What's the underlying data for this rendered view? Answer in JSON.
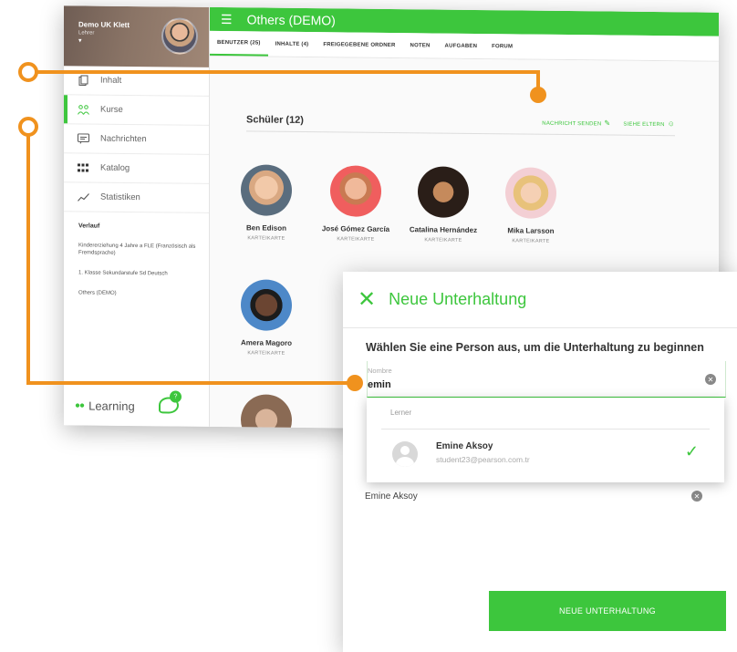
{
  "sidebar": {
    "profile_name": "Demo UK Klett",
    "profile_role": "Lehrer",
    "nav": [
      {
        "label": "Inhalt"
      },
      {
        "label": "Kurse"
      },
      {
        "label": "Nachrichten"
      },
      {
        "label": "Katalog"
      },
      {
        "label": "Statistiken"
      }
    ],
    "history_title": "Verlauf",
    "history": [
      "Kindererziehung 4 Jahre a FLE (Französisch als Fremdsprache)",
      "1. Klasse Sekundarstufe Sd Deutsch",
      "Others (DEMO)"
    ],
    "brand": "Learning",
    "chat_badge": "?"
  },
  "header": {
    "title": "Others (DEMO)",
    "tabs": [
      {
        "label": "BENUTZER (25)"
      },
      {
        "label": "INHALTE (4)"
      },
      {
        "label": "FREIGEGEBENE ORDNER"
      },
      {
        "label": "NOTEN"
      },
      {
        "label": "AUFGABEN"
      },
      {
        "label": "FORUM"
      }
    ]
  },
  "main": {
    "section_title": "Schüler (12)",
    "action_send": "NACHRICHT SENDEN",
    "action_parents": "SIEHE ELTERN",
    "students": [
      {
        "name": "Ben Edison",
        "tag": "KARTEIKARTE"
      },
      {
        "name": "José Gómez García",
        "tag": "KARTEIKARTE"
      },
      {
        "name": "Catalina Hernández",
        "tag": "KARTEIKARTE"
      },
      {
        "name": "Mika Larsson",
        "tag": "KARTEIKARTE"
      },
      {
        "name": "Amera Magoro",
        "tag": "KARTEIKARTE"
      }
    ]
  },
  "dialog": {
    "title": "Neue Unterhaltung",
    "instruction": "Wählen Sie eine Person aus, um die Unterhaltung zu beginnen",
    "field_label": "Nombre",
    "field_value": "emin",
    "dropdown_header": "Lerner",
    "result_name": "Emine Aksoy",
    "result_email": "student23@pearson.com.tr",
    "selected_name": "Emine Aksoy",
    "button_label": "NEUE UNTERHALTUNG"
  },
  "colors": {
    "accent": "#3dc63d",
    "callout": "#f0921e"
  }
}
